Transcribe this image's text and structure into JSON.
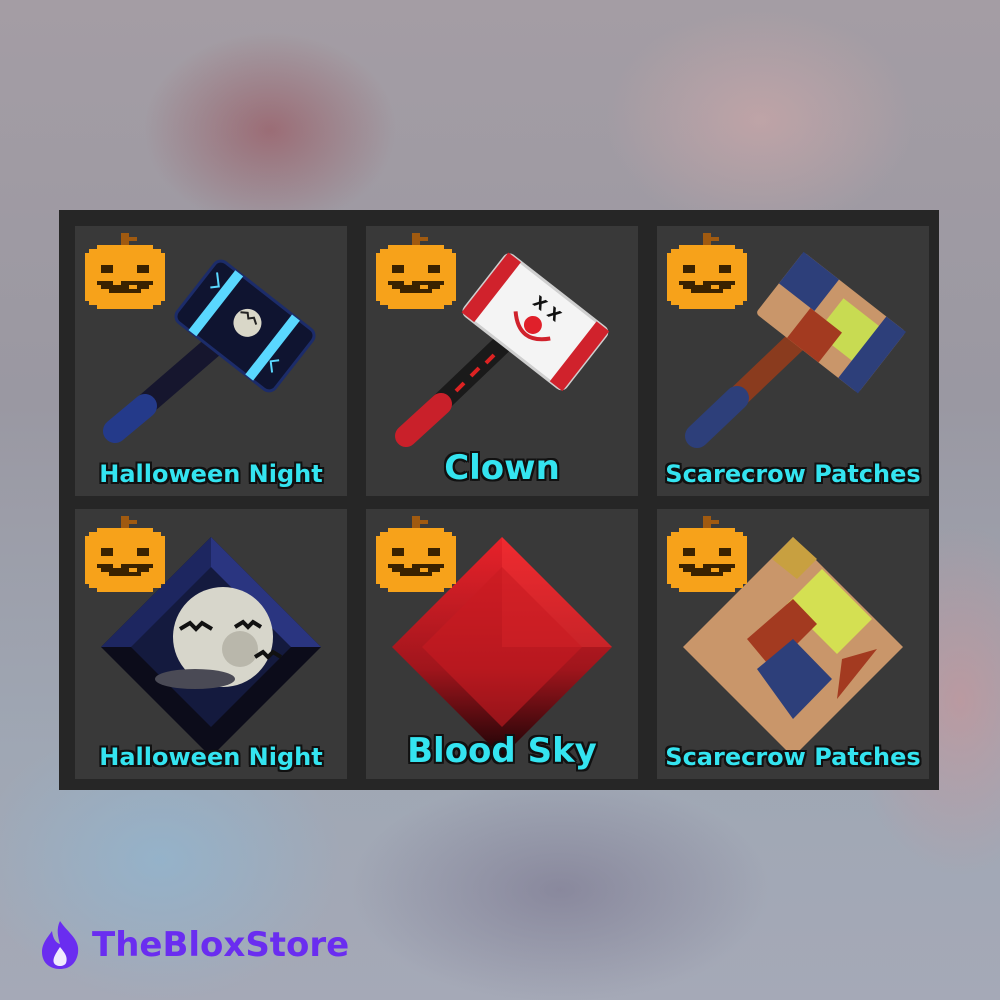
{
  "items": [
    {
      "label": "Halloween Night",
      "kind": "hammer",
      "badge": "pumpkin-icon"
    },
    {
      "label": "Clown",
      "kind": "hammer",
      "badge": "pumpkin-icon"
    },
    {
      "label": "Scarecrow Patches",
      "kind": "hammer",
      "badge": "pumpkin-icon"
    },
    {
      "label": "Halloween Night",
      "kind": "gem",
      "badge": "pumpkin-icon"
    },
    {
      "label": "Blood Sky",
      "kind": "gem",
      "badge": "pumpkin-icon"
    },
    {
      "label": "Scarecrow Patches",
      "kind": "gem",
      "badge": "pumpkin-icon"
    }
  ],
  "brand": {
    "name": "TheBloxStore",
    "icon": "flame-icon",
    "color": "#6a2df0"
  },
  "colors": {
    "label": "#34e4f0",
    "card": "#393939",
    "panel": "#262626",
    "pumpkin": "#f7a21a"
  }
}
